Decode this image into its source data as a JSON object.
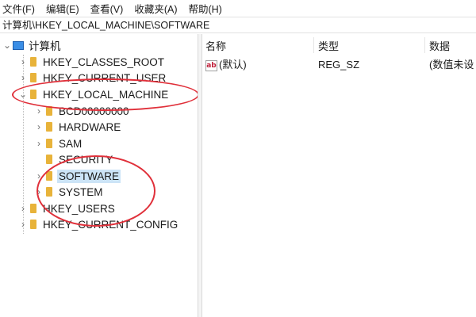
{
  "menu": [
    "文件(F)",
    "编辑(E)",
    "查看(V)",
    "收藏夹(A)",
    "帮助(H)"
  ],
  "address": "计算机\\HKEY_LOCAL_MACHINE\\SOFTWARE",
  "tree": {
    "root": "计算机",
    "hives": {
      "classes_root": "HKEY_CLASSES_ROOT",
      "current_user": "HKEY_CURRENT_USER",
      "local_machine": "HKEY_LOCAL_MACHINE",
      "users": "HKEY_USERS",
      "current_config": "HKEY_CURRENT_CONFIG"
    },
    "local_machine_children": {
      "bcd": "BCD00000000",
      "hardware": "HARDWARE",
      "sam": "SAM",
      "security": "SECURITY",
      "software": "SOFTWARE",
      "system": "SYSTEM"
    },
    "selected": "SOFTWARE"
  },
  "list": {
    "columns": {
      "name": "名称",
      "type": "类型",
      "data": "数据"
    },
    "rows": [
      {
        "icon": "ab",
        "name": "(默认)",
        "type": "REG_SZ",
        "data": "(数值未设"
      }
    ]
  },
  "colors": {
    "annotation": "#e0303a",
    "selection": "#cce4f7",
    "folder": "#e8b33a"
  }
}
